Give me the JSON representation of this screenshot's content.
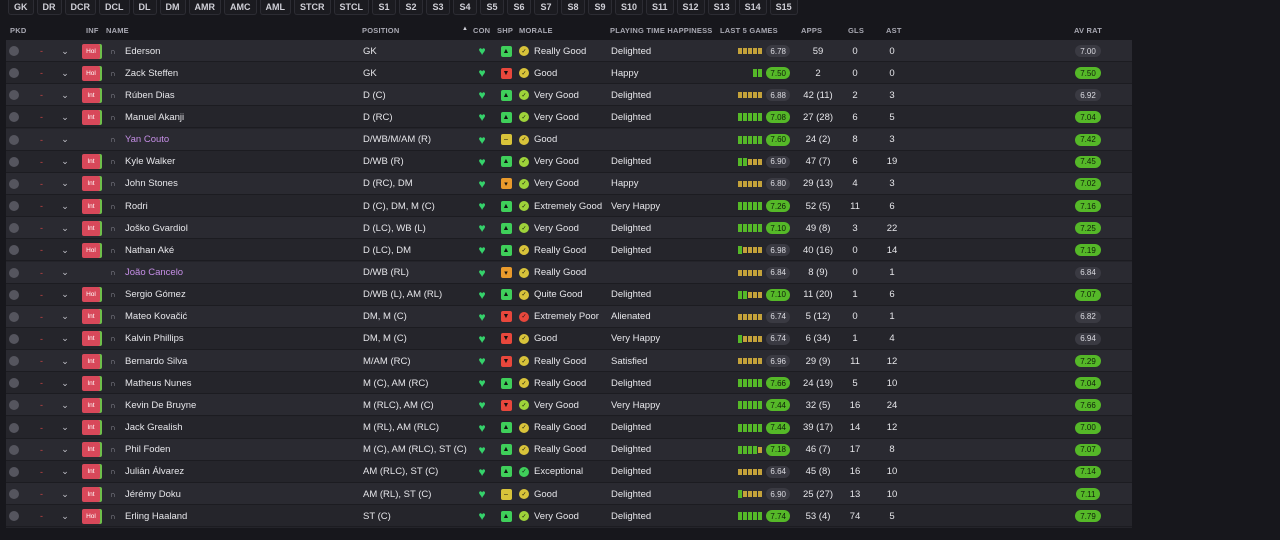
{
  "chips": [
    "GK",
    "DR",
    "DCR",
    "DCL",
    "DL",
    "DM",
    "AMR",
    "AMC",
    "AML",
    "STCR",
    "STCL",
    "S1",
    "S2",
    "S3",
    "S4",
    "S5",
    "S6",
    "S7",
    "S8",
    "S9",
    "S10",
    "S11",
    "S12",
    "S13",
    "S14",
    "S15"
  ],
  "headers": {
    "pkd": "PKD",
    "inf": "INF",
    "name": "NAME",
    "position": "POSITION",
    "con": "CON",
    "shp": "SHP",
    "morale": "MORALE",
    "happiness": "PLAYING TIME HAPPINESS",
    "last5": "LAST 5 GAMES",
    "apps": "APPS",
    "gls": "GLS",
    "ast": "AST",
    "avrat": "AV RAT"
  },
  "colors": {
    "accent_green": "#55b828",
    "con_green": "#35d36b",
    "injury_red": "#d8485a",
    "loan_purple": "#c58ee6"
  },
  "players": [
    {
      "inf": "Hol",
      "name": "Ederson",
      "position": "GK",
      "shp": "green",
      "morale": "Really Good",
      "happiness": "Delighted",
      "last5": [
        1,
        1,
        1,
        1,
        1
      ],
      "last_rat": "6.78",
      "last_good": false,
      "apps": "59",
      "gls": "0",
      "ast": "0",
      "avrat": "7.00",
      "av_good": false,
      "loan": false
    },
    {
      "inf": "Hol",
      "name": "Zack Steffen",
      "position": "GK",
      "shp": "red",
      "morale": "Good",
      "happiness": "Happy",
      "last5": [
        2,
        2
      ],
      "last_rat": "7.50",
      "last_good": true,
      "apps": "2",
      "gls": "0",
      "ast": "0",
      "avrat": "7.50",
      "av_good": true,
      "loan": false
    },
    {
      "inf": "Int",
      "name": "Rúben Dias",
      "position": "D (C)",
      "shp": "green",
      "morale": "Very Good",
      "happiness": "Delighted",
      "last5": [
        1,
        1,
        1,
        1,
        1
      ],
      "last_rat": "6.88",
      "last_good": false,
      "apps": "42 (11)",
      "gls": "2",
      "ast": "3",
      "avrat": "6.92",
      "av_good": false,
      "loan": false
    },
    {
      "inf": "Int",
      "name": "Manuel Akanji",
      "position": "D (RC)",
      "shp": "green",
      "morale": "Very Good",
      "happiness": "Delighted",
      "last5": [
        2,
        2,
        2,
        2,
        2
      ],
      "last_rat": "7.08",
      "last_good": true,
      "apps": "27 (28)",
      "gls": "6",
      "ast": "5",
      "avrat": "7.04",
      "av_good": true,
      "loan": false
    },
    {
      "inf": "",
      "name": "Yan Couto",
      "position": "D/WB/M/AM (R)",
      "shp": "yellow",
      "morale": "Good",
      "happiness": "",
      "last5": [
        2,
        2,
        2,
        2,
        2
      ],
      "last_rat": "7.60",
      "last_good": true,
      "apps": "24 (2)",
      "gls": "8",
      "ast": "3",
      "avrat": "7.42",
      "av_good": true,
      "loan": true
    },
    {
      "inf": "Int",
      "name": "Kyle Walker",
      "position": "D/WB (R)",
      "shp": "green",
      "morale": "Very Good",
      "happiness": "Delighted",
      "last5": [
        2,
        2,
        1,
        1,
        1
      ],
      "last_rat": "6.90",
      "last_good": false,
      "apps": "47 (7)",
      "gls": "6",
      "ast": "19",
      "avrat": "7.45",
      "av_good": true,
      "loan": false
    },
    {
      "inf": "Int",
      "name": "John Stones",
      "position": "D (RC), DM",
      "shp": "orange",
      "morale": "Very Good",
      "happiness": "Happy",
      "last5": [
        1,
        1,
        1,
        1,
        1
      ],
      "last_rat": "6.80",
      "last_good": false,
      "apps": "29 (13)",
      "gls": "4",
      "ast": "3",
      "avrat": "7.02",
      "av_good": true,
      "loan": false
    },
    {
      "inf": "Int",
      "name": "Rodri",
      "position": "D (C), DM, M (C)",
      "shp": "green",
      "morale": "Extremely Good",
      "happiness": "Very Happy",
      "last5": [
        2,
        2,
        2,
        2,
        2
      ],
      "last_rat": "7.26",
      "last_good": true,
      "apps": "52 (5)",
      "gls": "11",
      "ast": "6",
      "avrat": "7.16",
      "av_good": true,
      "loan": false
    },
    {
      "inf": "Int",
      "name": "Joško Gvardiol",
      "position": "D (LC), WB (L)",
      "shp": "green",
      "morale": "Very Good",
      "happiness": "Delighted",
      "last5": [
        2,
        2,
        2,
        2,
        2
      ],
      "last_rat": "7.10",
      "last_good": true,
      "apps": "49 (8)",
      "gls": "3",
      "ast": "22",
      "avrat": "7.25",
      "av_good": true,
      "loan": false
    },
    {
      "inf": "Hol",
      "name": "Nathan Aké",
      "position": "D (LC), DM",
      "shp": "green",
      "morale": "Really Good",
      "happiness": "Delighted",
      "last5": [
        2,
        1,
        1,
        1,
        1
      ],
      "last_rat": "6.98",
      "last_good": false,
      "apps": "40 (16)",
      "gls": "0",
      "ast": "14",
      "avrat": "7.19",
      "av_good": true,
      "loan": false
    },
    {
      "inf": "",
      "name": "João Cancelo",
      "position": "D/WB (RL)",
      "shp": "orange",
      "morale": "Really Good",
      "happiness": "",
      "last5": [
        1,
        1,
        1,
        1,
        1
      ],
      "last_rat": "6.84",
      "last_good": false,
      "apps": "8 (9)",
      "gls": "0",
      "ast": "1",
      "avrat": "6.84",
      "av_good": false,
      "loan": true
    },
    {
      "inf": "Hol",
      "name": "Sergio Gómez",
      "position": "D/WB (L), AM (RL)",
      "shp": "green",
      "morale": "Quite Good",
      "happiness": "Delighted",
      "last5": [
        2,
        2,
        1,
        1,
        1
      ],
      "last_rat": "7.10",
      "last_good": true,
      "apps": "11 (20)",
      "gls": "1",
      "ast": "6",
      "avrat": "7.07",
      "av_good": true,
      "loan": false
    },
    {
      "inf": "Int",
      "name": "Mateo Kovačić",
      "position": "DM, M (C)",
      "shp": "red",
      "morale": "Extremely Poor",
      "happiness": "Alienated",
      "last5": [
        1,
        1,
        1,
        1,
        1
      ],
      "last_rat": "6.74",
      "last_good": false,
      "apps": "5 (12)",
      "gls": "0",
      "ast": "1",
      "avrat": "6.82",
      "av_good": false,
      "loan": false
    },
    {
      "inf": "Int",
      "name": "Kalvin Phillips",
      "position": "DM, M (C)",
      "shp": "red",
      "morale": "Good",
      "happiness": "Very Happy",
      "last5": [
        2,
        1,
        1,
        1,
        1
      ],
      "last_rat": "6.74",
      "last_good": false,
      "apps": "6 (34)",
      "gls": "1",
      "ast": "4",
      "avrat": "6.94",
      "av_good": false,
      "loan": false
    },
    {
      "inf": "Int",
      "name": "Bernardo Silva",
      "position": "M/AM (RC)",
      "shp": "red",
      "morale": "Really Good",
      "happiness": "Satisfied",
      "last5": [
        1,
        1,
        1,
        1,
        1
      ],
      "last_rat": "6.96",
      "last_good": false,
      "apps": "29 (9)",
      "gls": "11",
      "ast": "12",
      "avrat": "7.29",
      "av_good": true,
      "loan": false
    },
    {
      "inf": "Int",
      "name": "Matheus Nunes",
      "position": "M (C), AM (RC)",
      "shp": "green",
      "morale": "Really Good",
      "happiness": "Delighted",
      "last5": [
        2,
        2,
        2,
        2,
        2
      ],
      "last_rat": "7.66",
      "last_good": true,
      "apps": "24 (19)",
      "gls": "5",
      "ast": "10",
      "avrat": "7.04",
      "av_good": true,
      "loan": false
    },
    {
      "inf": "Int",
      "name": "Kevin De Bruyne",
      "position": "M (RLC), AM (C)",
      "shp": "red",
      "morale": "Very Good",
      "happiness": "Very Happy",
      "last5": [
        2,
        2,
        2,
        2,
        2
      ],
      "last_rat": "7.44",
      "last_good": true,
      "apps": "32 (5)",
      "gls": "16",
      "ast": "24",
      "avrat": "7.66",
      "av_good": true,
      "loan": false
    },
    {
      "inf": "Int",
      "name": "Jack Grealish",
      "position": "M (RL), AM (RLC)",
      "shp": "green",
      "morale": "Really Good",
      "happiness": "Delighted",
      "last5": [
        2,
        2,
        2,
        2,
        2
      ],
      "last_rat": "7.44",
      "last_good": true,
      "apps": "39 (17)",
      "gls": "14",
      "ast": "12",
      "avrat": "7.00",
      "av_good": true,
      "loan": false
    },
    {
      "inf": "Int",
      "name": "Phil Foden",
      "position": "M (C), AM (RLC), ST (C)",
      "shp": "green",
      "morale": "Really Good",
      "happiness": "Delighted",
      "last5": [
        2,
        2,
        2,
        2,
        1
      ],
      "last_rat": "7.18",
      "last_good": true,
      "apps": "46 (7)",
      "gls": "17",
      "ast": "8",
      "avrat": "7.07",
      "av_good": true,
      "loan": false
    },
    {
      "inf": "Int",
      "name": "Julián Álvarez",
      "position": "AM (RLC), ST (C)",
      "shp": "green",
      "morale": "Exceptional",
      "happiness": "Delighted",
      "last5": [
        1,
        1,
        1,
        1,
        1
      ],
      "last_rat": "6.64",
      "last_good": false,
      "apps": "45 (8)",
      "gls": "16",
      "ast": "10",
      "avrat": "7.14",
      "av_good": true,
      "loan": false
    },
    {
      "inf": "Int",
      "name": "Jérémy Doku",
      "position": "AM (RL), ST (C)",
      "shp": "yellow",
      "morale": "Good",
      "happiness": "Delighted",
      "last5": [
        2,
        1,
        1,
        1,
        1
      ],
      "last_rat": "6.90",
      "last_good": false,
      "apps": "25 (27)",
      "gls": "13",
      "ast": "10",
      "avrat": "7.11",
      "av_good": true,
      "loan": false
    },
    {
      "inf": "Hol",
      "name": "Erling Haaland",
      "position": "ST (C)",
      "shp": "green",
      "morale": "Very Good",
      "happiness": "Delighted",
      "last5": [
        2,
        2,
        2,
        2,
        2
      ],
      "last_rat": "7.74",
      "last_good": true,
      "apps": "53 (4)",
      "gls": "74",
      "ast": "5",
      "avrat": "7.79",
      "av_good": true,
      "loan": false
    }
  ]
}
